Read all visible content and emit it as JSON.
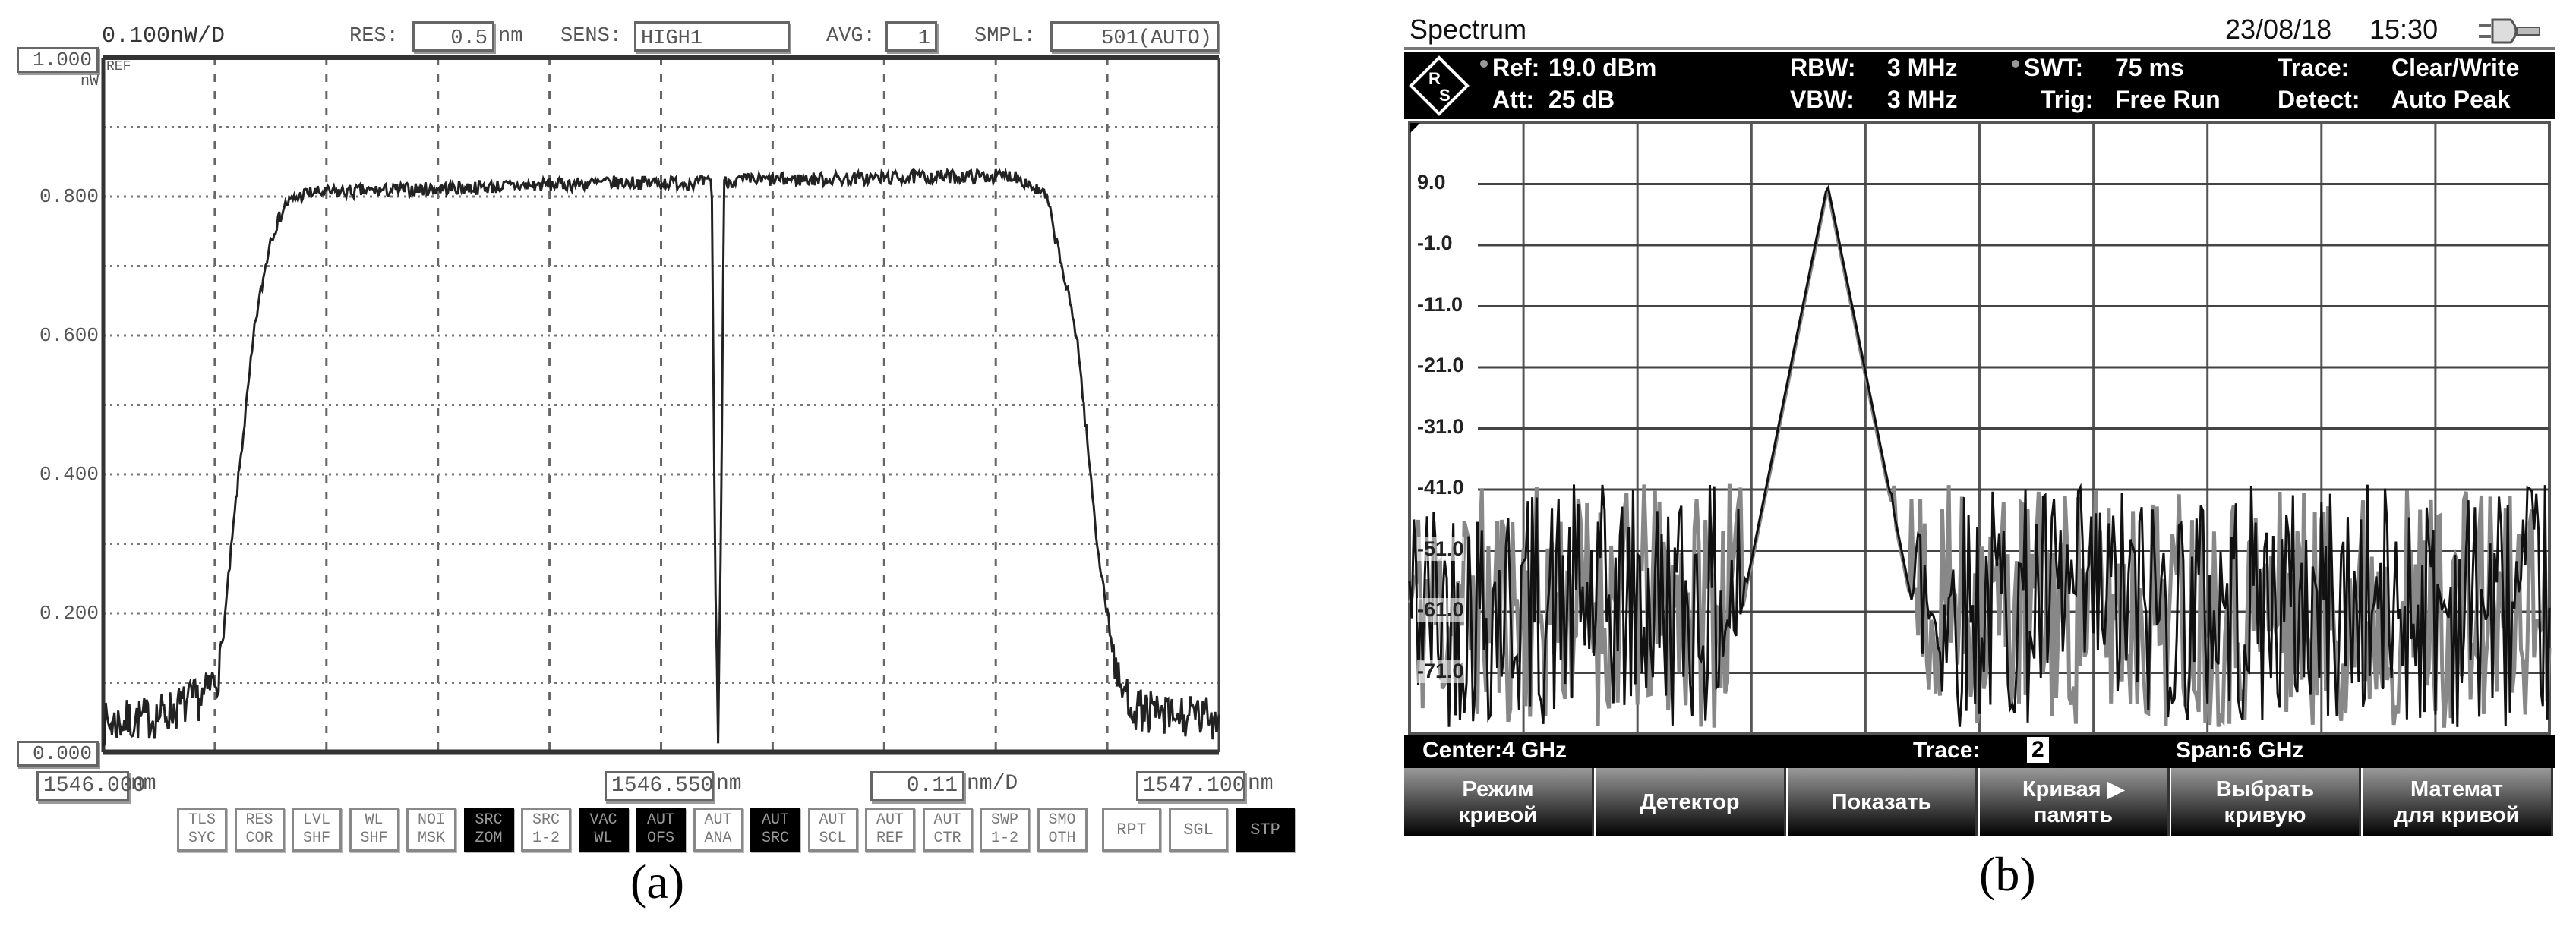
{
  "panel_a": {
    "scale_label": "0.100nW/D",
    "res_label": "RES:",
    "res_value": "0.5",
    "res_unit": "nm",
    "sens_label": "SENS:",
    "sens_value": "HIGH1",
    "avg_label": "AVG:",
    "avg_value": "1",
    "smpl_label": "SMPL:",
    "smpl_value": "501(AUTO)",
    "ref_value": "1.000",
    "ref_unit": "nW",
    "ref_tag": "REF",
    "y_ticks": [
      "0.800",
      "0.600",
      "0.400",
      "0.200"
    ],
    "bottom_value": "0.000",
    "x_start": "1546.000",
    "x_center": "1546.550",
    "x_per_div": "0.11",
    "x_per_div_unit": "nm/D",
    "x_end": "1547.100",
    "x_unit": "nm",
    "buttons": [
      {
        "l1": "TLS",
        "l2": "SYC",
        "active": false
      },
      {
        "l1": "RES",
        "l2": "COR",
        "active": false
      },
      {
        "l1": "LVL",
        "l2": "SHF",
        "active": false
      },
      {
        "l1": "WL",
        "l2": "SHF",
        "active": false
      },
      {
        "l1": "NOI",
        "l2": "MSK",
        "active": false
      },
      {
        "l1": "SRC",
        "l2": "ZOM",
        "active": true
      },
      {
        "l1": "SRC",
        "l2": "1-2",
        "active": false
      },
      {
        "l1": "VAC",
        "l2": "WL",
        "active": true
      },
      {
        "l1": "AUT",
        "l2": "OFS",
        "active": true
      },
      {
        "l1": "AUT",
        "l2": "ANA",
        "active": false
      },
      {
        "l1": "AUT",
        "l2": "SRC",
        "active": true
      },
      {
        "l1": "AUT",
        "l2": "SCL",
        "active": false
      },
      {
        "l1": "AUT",
        "l2": "REF",
        "active": false
      },
      {
        "l1": "AUT",
        "l2": "CTR",
        "active": false
      },
      {
        "l1": "SWP",
        "l2": "1-2",
        "active": false
      },
      {
        "l1": "SMO",
        "l2": "OTH",
        "active": false
      }
    ],
    "right_buttons": [
      {
        "label": "RPT",
        "active": false
      },
      {
        "label": "SGL",
        "active": false
      },
      {
        "label": "STP",
        "active": true
      }
    ],
    "caption": "(a)"
  },
  "panel_b": {
    "title": "Spectrum",
    "date": "23/08/18",
    "time": "15:30",
    "ref_label": "Ref:",
    "ref_value": "19.0 dBm",
    "att_label": "Att:",
    "att_value": "25 dB",
    "rbw_label": "RBW:",
    "rbw_value": "3 MHz",
    "vbw_label": "VBW:",
    "vbw_value": "3 MHz",
    "swt_label": "SWT:",
    "swt_value": "75 ms",
    "trig_label": "Trig:",
    "trig_value": "Free Run",
    "trace_label": "Trace:",
    "trace_value": "Clear/Write",
    "detect_label": "Detect:",
    "detect_value": "Auto Peak",
    "y_ticks": [
      "9.0",
      "-1.0",
      "-11.0",
      "-21.0",
      "-31.0",
      "-41.0",
      "-51.0",
      "-61.0",
      "-71.0"
    ],
    "center": "Center:4 GHz",
    "status_trace_label": "Trace:",
    "status_trace_value": "2",
    "span": "Span:6 GHz",
    "softkeys": [
      {
        "l1": "Режим",
        "l2": "кривой"
      },
      {
        "l1": "Детектор",
        "l2": ""
      },
      {
        "l1": "Показать",
        "l2": ""
      },
      {
        "l1": "Кривая ▶",
        "l2": "память"
      },
      {
        "l1": "Выбрать",
        "l2": "кривую"
      },
      {
        "l1": "Математ",
        "l2": "для кривой"
      }
    ],
    "caption": "(b)"
  },
  "chart_data": [
    {
      "type": "line",
      "x_unit": "nm",
      "y_unit": "nW",
      "xlim": [
        1546.0,
        1547.1
      ],
      "ylim": [
        0.0,
        1.0
      ],
      "x_divisions": 10,
      "y_divisions": 10,
      "grid": true,
      "x": [
        1546.0,
        1546.05,
        1546.1,
        1546.115,
        1546.13,
        1546.15,
        1546.165,
        1546.18,
        1546.2,
        1546.3,
        1546.4,
        1546.5,
        1546.6,
        1546.603,
        1546.606,
        1546.609,
        1546.612,
        1546.62,
        1546.7,
        1546.8,
        1546.9,
        1546.93,
        1546.96,
        1546.98,
        1547.0,
        1547.02,
        1547.05,
        1547.1
      ],
      "y": [
        0.04,
        0.05,
        0.08,
        0.12,
        0.35,
        0.62,
        0.74,
        0.79,
        0.805,
        0.81,
        0.815,
        0.82,
        0.82,
        0.3,
        0.02,
        0.3,
        0.82,
        0.823,
        0.825,
        0.828,
        0.83,
        0.8,
        0.6,
        0.3,
        0.1,
        0.06,
        0.05,
        0.05
      ],
      "noise_amplitude": 0.02
    },
    {
      "type": "line",
      "x_unit": "GHz",
      "y_unit": "dBm",
      "xlim": [
        1.0,
        7.0
      ],
      "ylim": [
        -81.0,
        19.0
      ],
      "x_divisions": 10,
      "y_divisions": 10,
      "grid": true,
      "peak": {
        "x": 3.2,
        "y": 9.0
      },
      "noise_floor_range": [
        -80.0,
        -40.0
      ],
      "series": [
        {
          "name": "trace-1",
          "color": "#888888"
        },
        {
          "name": "trace-2",
          "color": "#111111"
        }
      ]
    }
  ]
}
